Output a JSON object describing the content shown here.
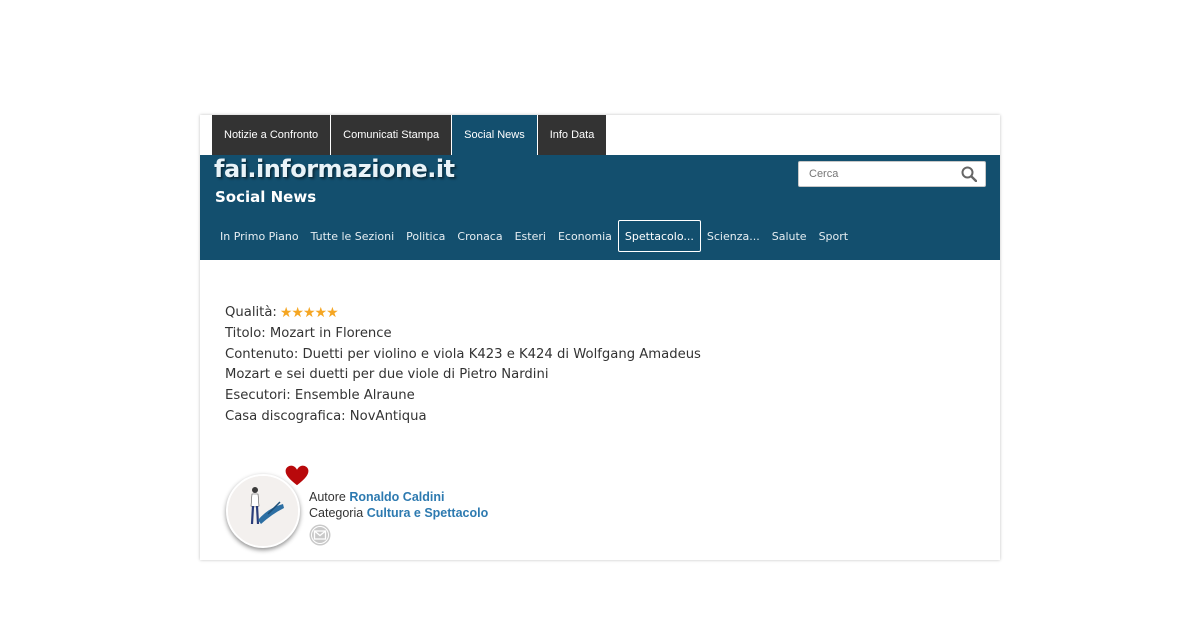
{
  "topnav": {
    "tabs": [
      {
        "label": "Notizie a Confronto"
      },
      {
        "label": "Comunicati Stampa"
      },
      {
        "label": "Social News"
      },
      {
        "label": "Info Data"
      }
    ],
    "active": "Social News"
  },
  "header": {
    "logo": "fai.informazione.it",
    "subtitle": "Social News",
    "background_color": "#134f6e"
  },
  "search": {
    "placeholder": "Cerca"
  },
  "secnav": {
    "items": [
      {
        "label": "In Primo Piano"
      },
      {
        "label": "Tutte le Sezioni"
      },
      {
        "label": "Politica"
      },
      {
        "label": "Cronaca"
      },
      {
        "label": "Esteri"
      },
      {
        "label": "Economia"
      },
      {
        "label": "Spettacolo..."
      },
      {
        "label": "Scienza..."
      },
      {
        "label": "Salute"
      },
      {
        "label": "Sport"
      }
    ],
    "active": "Spettacolo..."
  },
  "article": {
    "quality_label": "Qualità:",
    "quality_stars": 5,
    "title_line": "Titolo: Mozart in Florence",
    "content_line1": "Contenuto: Duetti per violino e viola K423 e K424 di Wolfgang Amadeus",
    "content_line2": "Mozart e sei duetti per due viole di Pietro Nardini",
    "performers_line": "Esecutori: Ensemble Alraune",
    "label_line": "Casa discografica: NovAntiqua"
  },
  "author": {
    "author_label": "Autore",
    "author_name": "Ronaldo Caldini",
    "category_label": "Categoria",
    "category_name": "Cultura e Spettacolo",
    "icons": [
      "heart-icon",
      "mail-icon"
    ]
  }
}
